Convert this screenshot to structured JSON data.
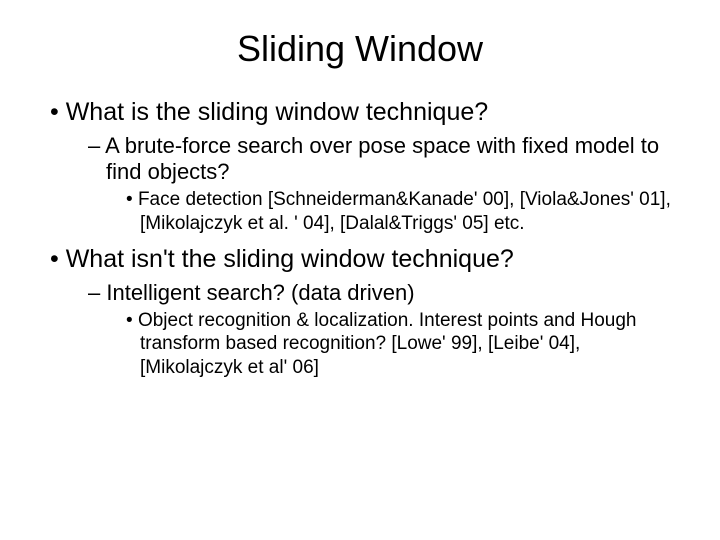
{
  "title": "Sliding Window",
  "b1": "What is the sliding window technique?",
  "b1_1": "A brute-force search over pose space with fixed model to find objects?",
  "b1_1_1": "Face detection [Schneiderman&Kanade' 00], [Viola&Jones' 01], [Mikolajczyk et al. ' 04], [Dalal&Triggs' 05] etc.",
  "b2": "What isn't the sliding window technique?",
  "b2_1": "Intelligent search? (data driven)",
  "b2_1_1": "Object recognition & localization. Interest points and Hough transform based recognition? [Lowe' 99], [Leibe' 04], [Mikolajczyk et al' 06]"
}
